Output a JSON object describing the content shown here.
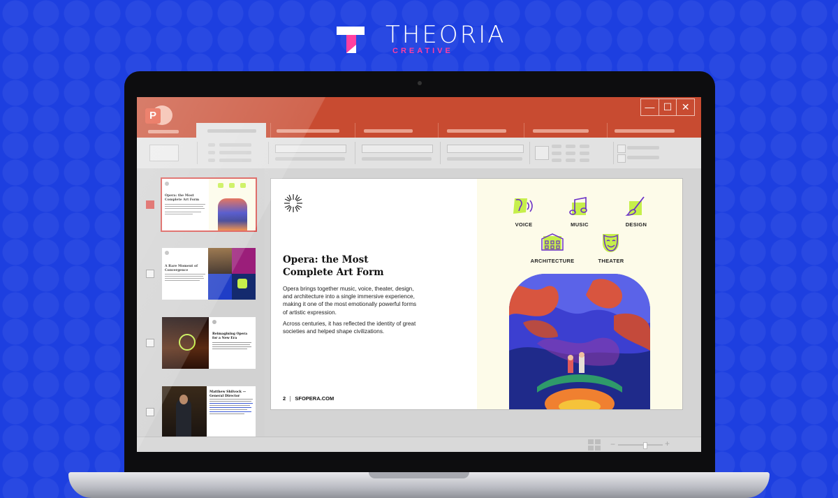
{
  "brand": {
    "name": "THEORIA",
    "sub": "CREATIVE",
    "colors": {
      "background": "#1d3fe0",
      "accent": "#ff3fa0"
    }
  },
  "app": {
    "icon": "powerpoint-icon",
    "theme_color": "#c84b31",
    "window_controls": {
      "minimize": "—",
      "maximize": "☐",
      "close": "✕"
    }
  },
  "thumbnails": [
    {
      "title": "Opera: the Most Complete Art Form",
      "selected": true
    },
    {
      "title": "A Rare Moment of Convergence",
      "selected": false
    },
    {
      "title": "Reimagining Opera for a New Era",
      "selected": false
    },
    {
      "title": "Matthew Shilvock — General Director",
      "selected": false
    }
  ],
  "slide": {
    "title_line1": "Opera: the Most",
    "title_line2": "Complete Art Form",
    "body_p1": "Opera brings together music, voice, theater, design, and architecture into a single immersive experience, making it one of the most emotionally powerful forms of artistic expression.",
    "body_p2": "Across centuries, it has reflected the identity of great societies and helped shape civilizations.",
    "page_number": "2",
    "footer": "SFOPERA.COM",
    "icons": [
      {
        "label": "VOICE",
        "icon": "voice-icon"
      },
      {
        "label": "MUSIC",
        "icon": "music-note-icon"
      },
      {
        "label": "DESIGN",
        "icon": "paintbrush-icon"
      },
      {
        "label": "ARCHITECTURE",
        "icon": "building-icon"
      },
      {
        "label": "THEATER",
        "icon": "theater-mask-icon"
      }
    ]
  },
  "statusbar": {
    "zoom_minus": "−",
    "zoom_plus": "+",
    "zoom_level": 0.6
  }
}
